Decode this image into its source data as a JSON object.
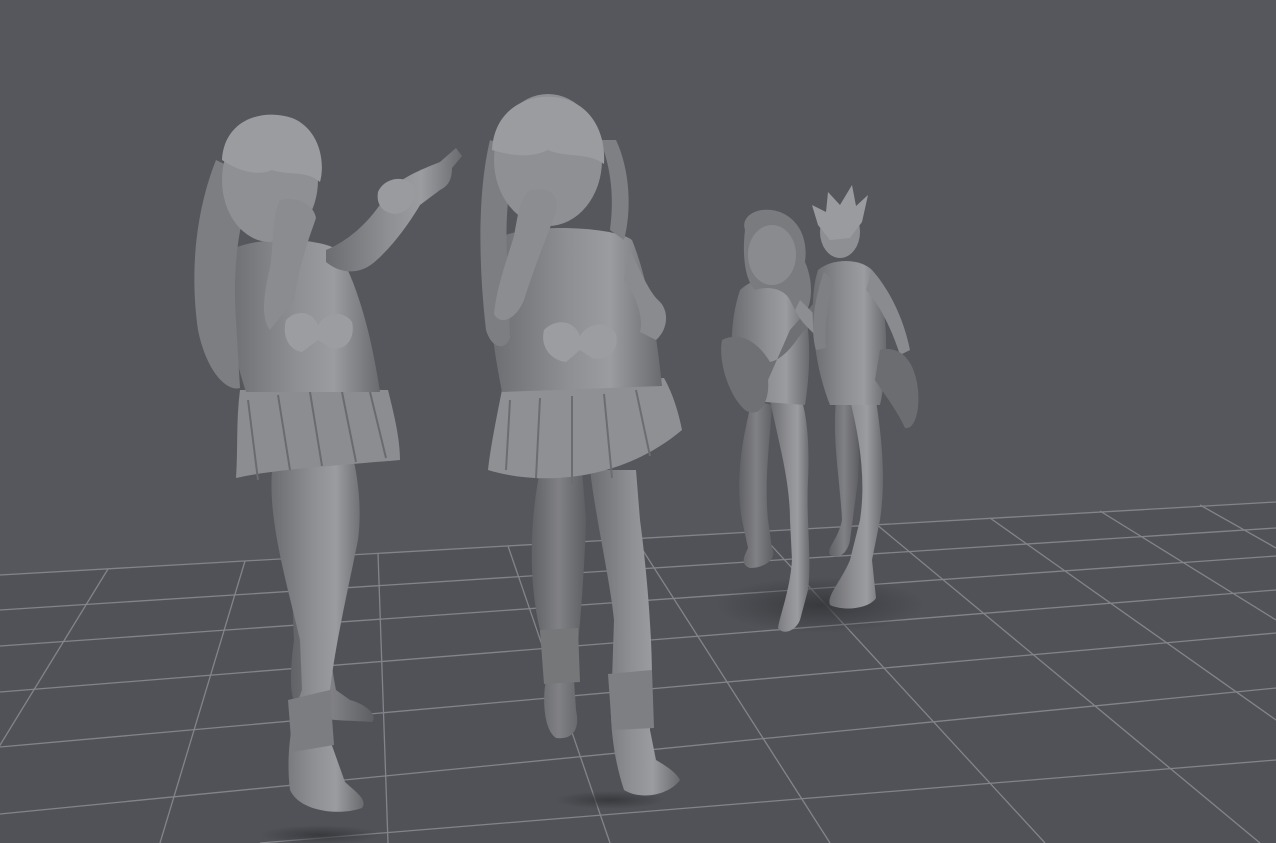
{
  "viewport": {
    "background_color": "#56575c",
    "ground_color": "#515257",
    "grid_color": "#8c8d92",
    "model_color": "#818286",
    "model_highlight_color": "#a6a7ab",
    "model_shadow_color": "#5f6064",
    "shadow_color": "#3e3f43",
    "show_grid": true
  },
  "scene": {
    "models": [
      {
        "label": "figure-pointing-girl",
        "icon": "3d-model-icon"
      },
      {
        "label": "figure-girl-hand-to-mouth",
        "icon": "3d-model-icon"
      },
      {
        "label": "figure-guitar-girl",
        "icon": "3d-model-icon"
      },
      {
        "label": "figure-spiky-hair-boy",
        "icon": "3d-model-icon"
      }
    ]
  }
}
